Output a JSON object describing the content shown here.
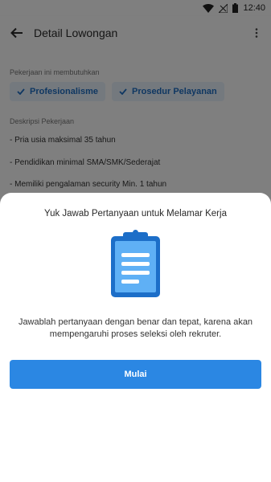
{
  "status_bar": {
    "time": "12:40"
  },
  "app_bar": {
    "title": "Detail Lowongan"
  },
  "requirements": {
    "label": "Pekerjaan ini membutuhkan",
    "chips": [
      "Profesionalisme",
      "Prosedur Pelayanan"
    ]
  },
  "description": {
    "label": "Deskripsi Pekerjaan",
    "lines": [
      "- Pria usia maksimal 35 tahun",
      "- Pendidikan minimal SMA/SMK/Sederajat",
      "- Memiliki pengalaman security Min. 1 tahun"
    ]
  },
  "sheet": {
    "title": "Yuk Jawab Pertanyaan untuk Melamar Kerja",
    "description": "Jawablah pertanyaan dengan benar dan tepat, karena akan mempengaruhi proses seleksi oleh rekruter.",
    "button_label": "Mulai"
  },
  "colors": {
    "accent": "#2b87e3",
    "chip_bg": "#e9f2fc",
    "chip_text": "#1f6fc4"
  }
}
